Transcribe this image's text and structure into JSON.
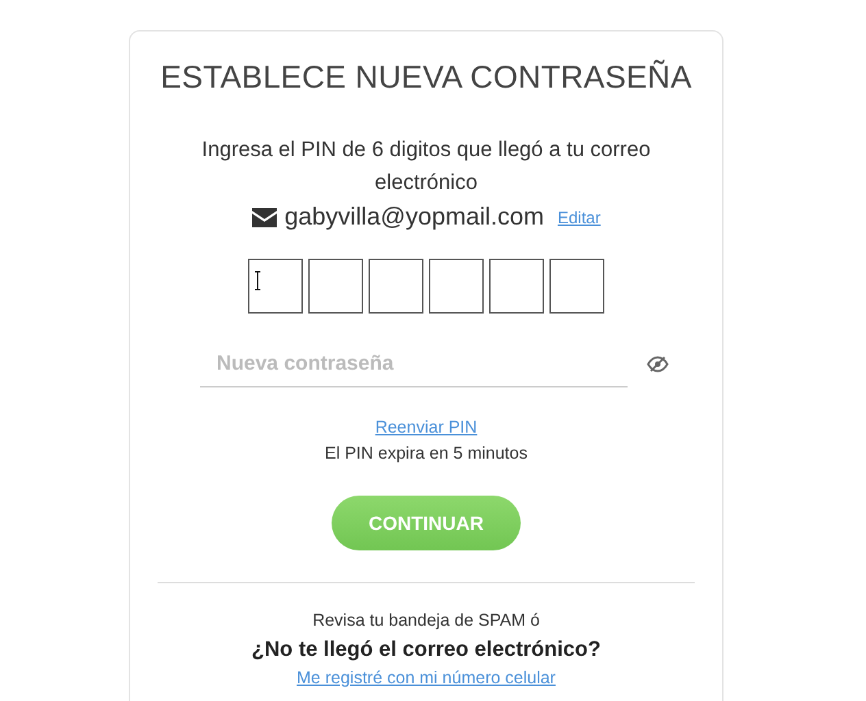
{
  "title": "ESTABLECE NUEVA CONTRASEÑA",
  "instructions": "Ingresa el PIN de 6 digitos que llegó a tu correo electrónico",
  "email": {
    "address": "gabyvilla@yopmail.com",
    "edit_link": "Editar"
  },
  "pin_boxes": [
    {
      "kind": "digit"
    },
    {
      "kind": "digit"
    },
    {
      "kind": "digit"
    },
    {
      "kind": "digit"
    },
    {
      "kind": "digit"
    },
    {
      "kind": "digit"
    }
  ],
  "password": {
    "placeholder": "Nueva contraseña"
  },
  "resend_link": "Reenviar PIN",
  "expiry_note": "El PIN expira en 5 minutos",
  "continue_button": "CONTINUAR",
  "spam_note": "Revisa tu bandeja de SPAM ó",
  "question": "¿No te llegó el correo electrónico?",
  "phone_link": "Me registré con mi número celular"
}
